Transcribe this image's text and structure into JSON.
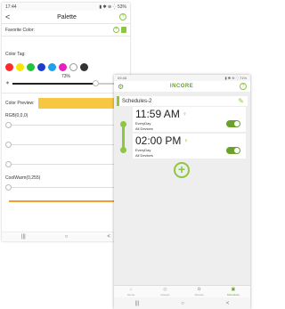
{
  "palette": {
    "status": {
      "time": "17:44",
      "right": "▮ ✱ ⊕ ⁛ 53%"
    },
    "back": "<",
    "title": "Palette",
    "help": "?",
    "favorite_label": "Favorite Color:",
    "color_tag_label": "Color Tag:",
    "swatches": [
      "#ff2a2a",
      "#f4e600",
      "#22c53a",
      "#1f3ccf",
      "#1fa0e8",
      "#e81fc0",
      "#ffffff",
      "#333333"
    ],
    "brightness": {
      "value": 0.73,
      "text": "73%"
    },
    "preview_label": "Color Preview:",
    "preview_color": "#f8c741",
    "rgb_label": "RGB(0,0,0)",
    "cw_label": "CoolWarm(0,255)",
    "nav": [
      "|||",
      "○",
      "<"
    ]
  },
  "schedules": {
    "status": {
      "time": "09:48",
      "right": "▮ ✱ ⊕ ⁛ 71%"
    },
    "brand": "INCORE",
    "help": "?",
    "group": "Schedules-2",
    "items": [
      {
        "time": "11:59 AM",
        "repeat": "EveryDay",
        "target": "All Devices",
        "enabled": true
      },
      {
        "time": "02:00 PM",
        "repeat": "EveryDay",
        "target": "All Devices",
        "enabled": true
      }
    ],
    "add": "+",
    "tabs": [
      {
        "label": "Home",
        "icon": "home-icon"
      },
      {
        "label": "Groups",
        "icon": "groups-icon"
      },
      {
        "label": "Scenes",
        "icon": "scenes-icon"
      },
      {
        "label": "Schedules",
        "icon": "calendar-icon"
      }
    ],
    "nav": [
      "|||",
      "○",
      "<"
    ],
    "accent": "#8dc63f"
  }
}
